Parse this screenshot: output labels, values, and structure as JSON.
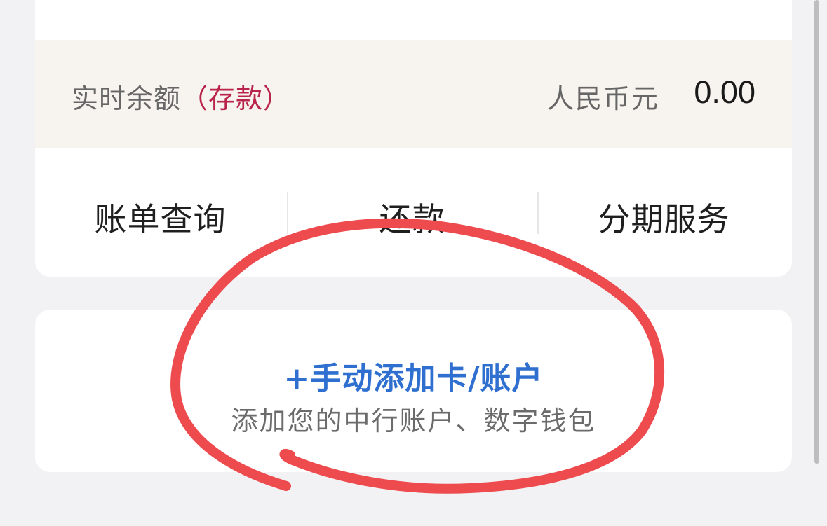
{
  "balance": {
    "label": "实时余额",
    "tag": "（存款）",
    "currency": "人民币元",
    "amount": "0.00"
  },
  "actions": [
    {
      "label": "账单查询"
    },
    {
      "label": "还款"
    },
    {
      "label": "分期服务"
    }
  ],
  "add_account": {
    "title": "+手动添加卡/账户",
    "subtitle": "添加您的中行账户、数字钱包"
  },
  "colors": {
    "accent_blue": "#2f6fcf",
    "tag_red": "#b8244a",
    "annotation_red": "#ee4b4f",
    "balance_band": "#f7f4ef"
  }
}
